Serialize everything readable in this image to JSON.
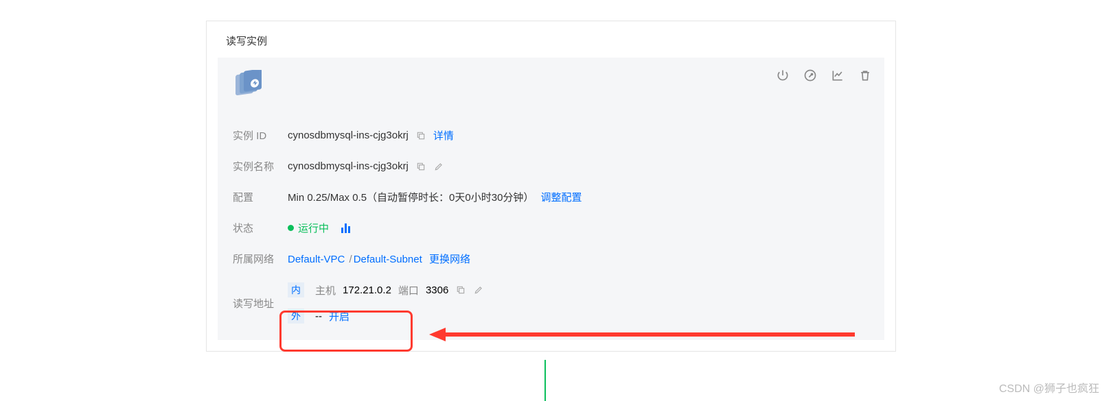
{
  "card": {
    "title": "读写实例"
  },
  "instance": {
    "id_label": "实例 ID",
    "id_value": "cynosdbmysql-ins-cjg3okrj",
    "detail_link": "详情",
    "name_label": "实例名称",
    "name_value": "cynosdbmysql-ins-cjg3okrj",
    "config_label": "配置",
    "config_value": "Min 0.25/Max 0.5（自动暂停时长：0天0小时30分钟）",
    "config_adjust": "调整配置",
    "status_label": "状态",
    "status_value": "运行中",
    "network_label": "所属网络",
    "network_vpc": "Default-VPC",
    "network_subnet": "Default-Subnet",
    "network_change": "更换网络",
    "addr_label": "读写地址",
    "addr_internal_tag": "内",
    "addr_host_label": "主机",
    "addr_host_value": "172.21.0.2",
    "addr_port_label": "端口",
    "addr_port_value": "3306",
    "addr_external_tag": "外",
    "addr_external_value": "--",
    "addr_external_enable": "开启"
  },
  "watermark": "CSDN @狮子也疯狂"
}
